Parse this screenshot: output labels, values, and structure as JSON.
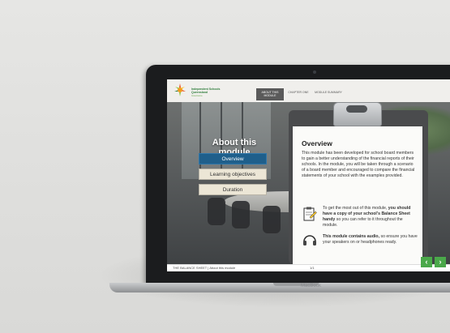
{
  "app": {
    "logo_name": "Independent Schools Queensland",
    "logo_sub": "Governance"
  },
  "nav": {
    "tabs": [
      {
        "label": "ABOUT THIS MODULE",
        "active": true
      },
      {
        "label": "CHAPTER ONE",
        "active": false
      },
      {
        "label": "MODULE SUMMARY",
        "active": false
      }
    ]
  },
  "module": {
    "title": "About this module",
    "buttons": [
      {
        "label": "Overview",
        "active": true
      },
      {
        "label": "Learning objectives",
        "active": false
      },
      {
        "label": "Duration",
        "active": false
      }
    ]
  },
  "panel": {
    "title": "Overview",
    "body": "This module has been developed for school board members to gain a better understanding of the financial reports of their schools. In the module, you will be taken through a scenario of a board member and encouraged to compare the financial statements of your school with the examples provided.",
    "tip1_plain": "To get the most out of this module, ",
    "tip1_bold": "you should have a copy of your school's Balance Sheet handy",
    "tip1_end": " so you can refer to it throughout the module.",
    "tip2_bold": "This module contains audio,",
    "tip2_end": " so ensure you have your speakers on or headphones ready.",
    "tip1_icon": "clipboard-document-icon",
    "tip2_icon": "headphones-icon"
  },
  "footer": {
    "breadcrumb": "THE BALANCE SHEET | About this module",
    "page": "1/1"
  },
  "controls": {
    "prev_icon": "chevron-left-icon",
    "next_icon": "chevron-right-icon",
    "prev_glyph": "‹",
    "next_glyph": "›"
  },
  "device": {
    "brand": "MacBook"
  },
  "colors": {
    "accent_blue": "#1f5f8b",
    "nav_green": "#4aa84a",
    "logo_green": "#2f7d3b"
  }
}
